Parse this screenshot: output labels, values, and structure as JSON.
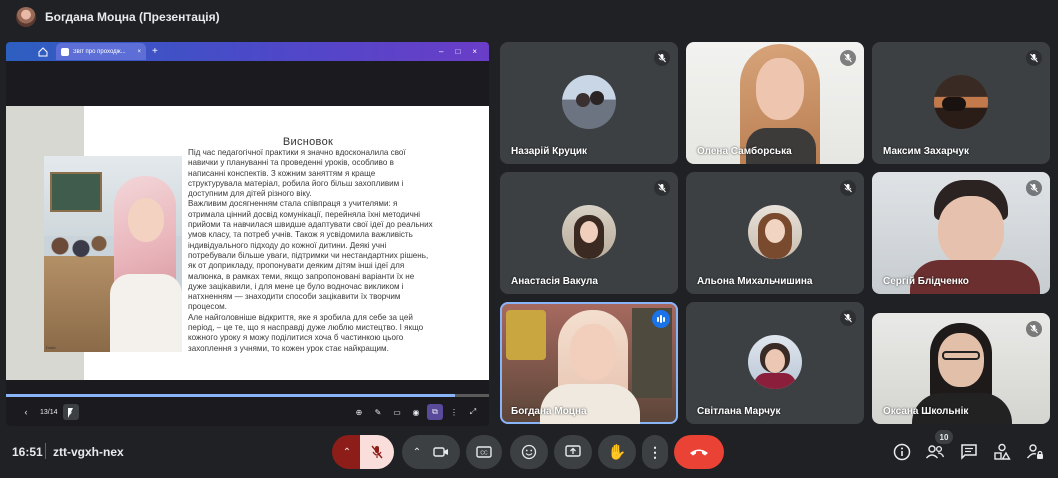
{
  "header": {
    "title": "Богдана Моцна (Презентація)"
  },
  "browser": {
    "tab_title": "Звіт про проходж..."
  },
  "slide": {
    "title": "Висновок",
    "photo_caption": "Dodo",
    "text": "Під час педагогічної практики я значно вдосконалила свої\nнавички у плануванні та проведенні уроків, особливо в\nнаписанні конспектів. З кожним заняттям я краще\nструктурувала матеріал, робила його більш захопливим і\nдоступним для дітей різного віку.\nВажливим досягненням стала співпраця з учителями: я\nотримала цінний досвід комунікації, перейняла їхні методичні\nприйоми та навчилася швидше адаптувати свої ідеї до реальних\nумов класу, та потреб учнів. Також я усвідомила важливість\nіндивідуального підходу до кожної дитини. Деякі учні\nпотребували більше уваги, підтримки чи нестандартних рішень,\nяк от доприкладу, пропонувати деяким дітям інші ідеї для\nмалюнка, в рамках теми, якщо запропоновані варіанти їх не\nдуже зацікавили, і для мене це було водночас викликом і\nнатхненням — знаходити способи зацікавити їх творчим\nпроцесом.\nАле найголовніше відкриття, яке я зробила для себе за цей\nперіод, – це те, що я насправді дуже люблю мистецтво. І якщо\nкожного уроку я можу поділитися хоча б частинкою цього\nзахоплення з учнями, то кожен урок стає найкращим."
  },
  "presentation_controls": {
    "page": "13/14",
    "progress": 0.93
  },
  "participants": [
    {
      "name": "Назарій Круцик",
      "muted": true
    },
    {
      "name": "Олена Самборська",
      "muted": true
    },
    {
      "name": "Максим Захарчук",
      "muted": true
    },
    {
      "name": "Анастасія Вакула",
      "muted": true
    },
    {
      "name": "Альона Михальчишина",
      "muted": true
    },
    {
      "name": "Сергій Блідченко",
      "muted": true
    },
    {
      "name": "Богдана Моцна",
      "speaking": true
    },
    {
      "name": "Світлана Марчук",
      "muted": true
    },
    {
      "name": "Оксана Школьнік",
      "muted": true
    }
  ],
  "meeting": {
    "time": "16:51",
    "code": "ztt-vgxh-nex",
    "people_count": "10"
  },
  "colors": {
    "accent": "#8ab4f8",
    "hangup": "#ea4335",
    "mic_off_bg": "#f9dedc",
    "tile_bg": "#3c4043"
  }
}
